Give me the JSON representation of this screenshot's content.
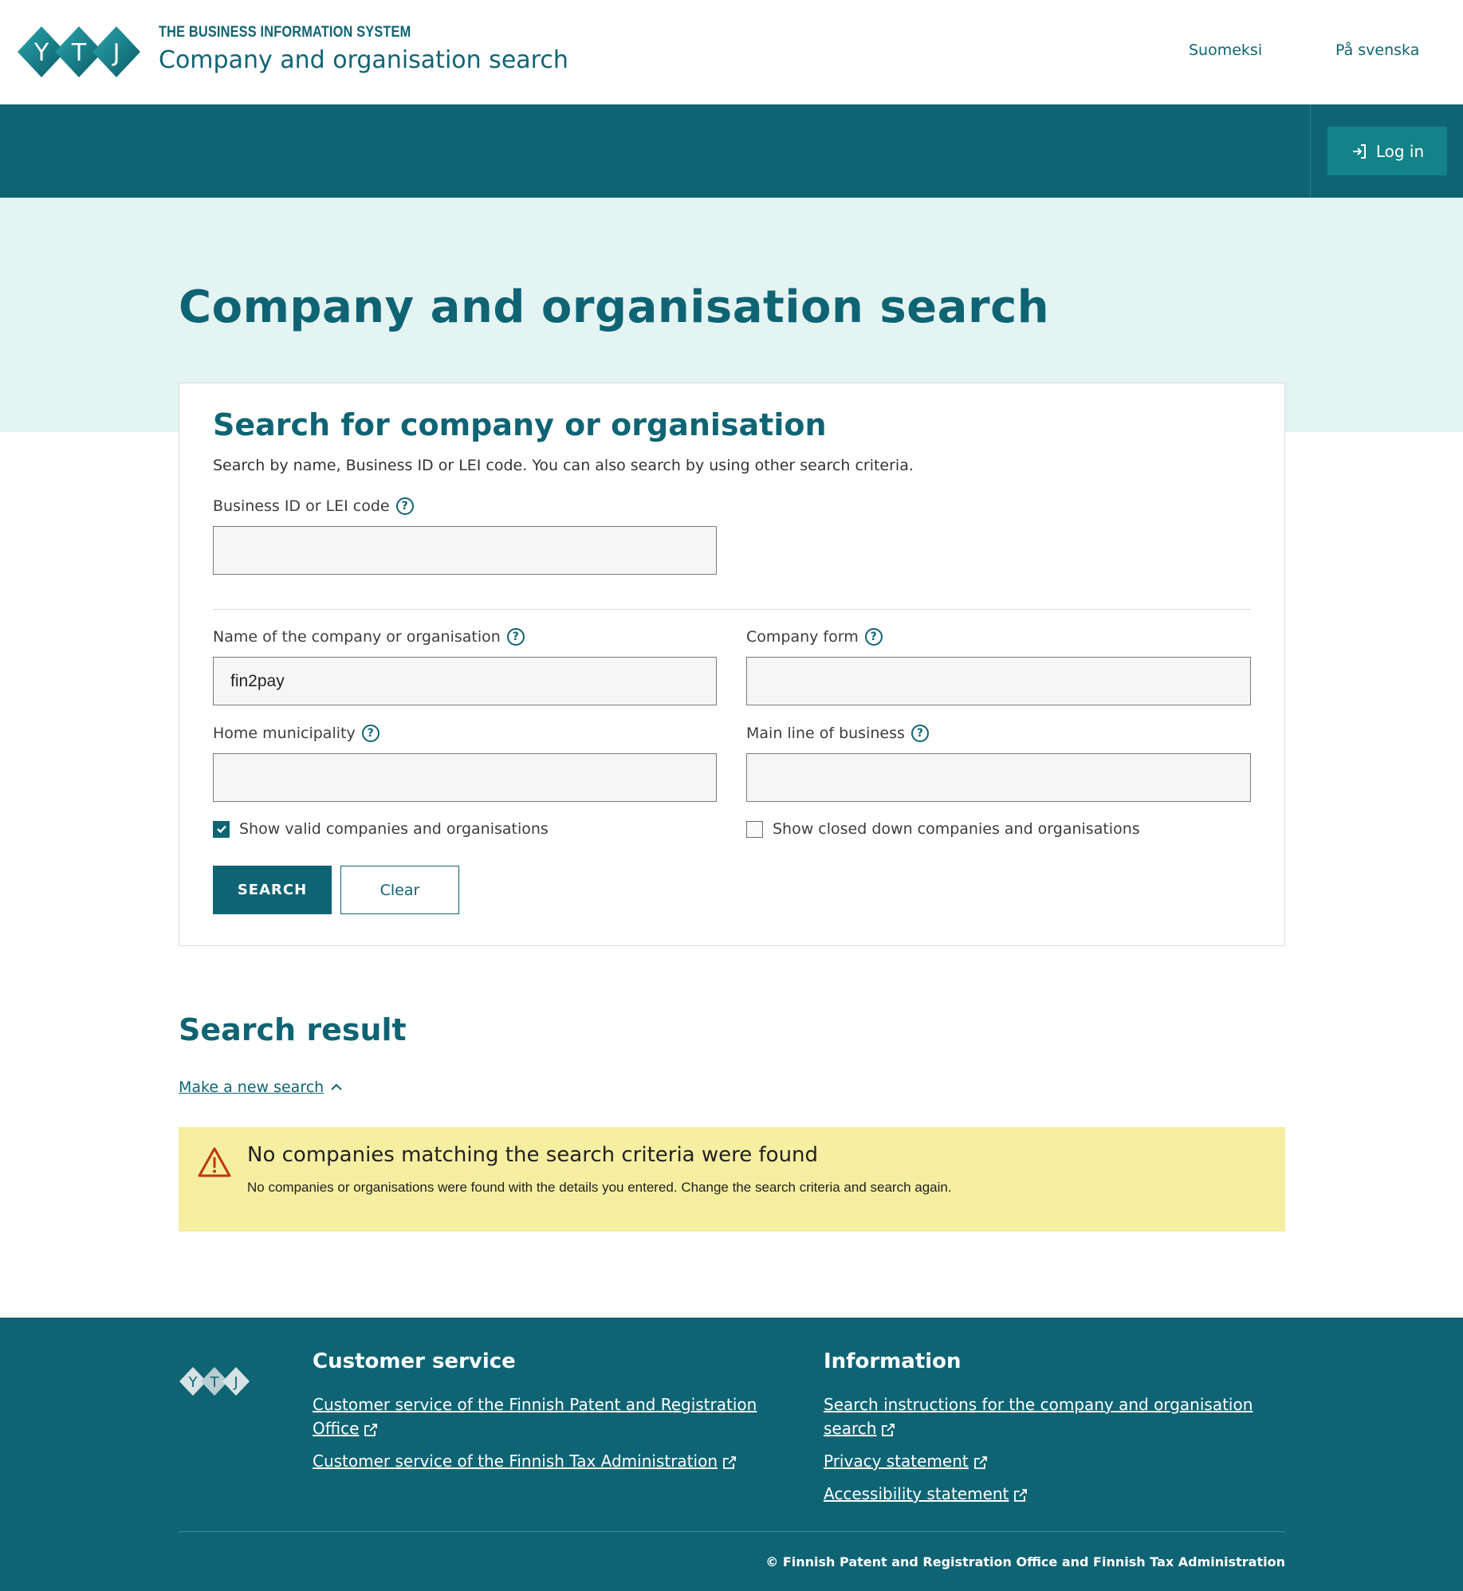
{
  "header": {
    "logo_text": "YTJ",
    "kicker": "THE BUSINESS INFORMATION SYSTEM",
    "title": "Company and organisation search",
    "lang_fi": "Suomeksi",
    "lang_sv": "På svenska"
  },
  "nav": {
    "login_label": "Log in"
  },
  "hero": {
    "title": "Company and organisation search"
  },
  "search_form": {
    "title": "Search for company or organisation",
    "description": "Search by name, Business ID or LEI code. You can also search by using other search criteria.",
    "business_id": {
      "label": "Business ID or LEI code",
      "value": ""
    },
    "name": {
      "label": "Name of the company or organisation",
      "value": "fin2pay"
    },
    "company_form": {
      "label": "Company form",
      "value": ""
    },
    "home_municipality": {
      "label": "Home municipality",
      "value": ""
    },
    "main_line": {
      "label": "Main line of business",
      "value": ""
    },
    "show_valid": {
      "label": "Show valid companies and organisations",
      "checked": true
    },
    "show_closed": {
      "label": "Show closed down companies and organisations",
      "checked": false
    },
    "search_label": "SEARCH",
    "clear_label": "Clear"
  },
  "results": {
    "title": "Search result",
    "new_search_label": "Make a new search",
    "alert_title": "No companies matching the search criteria were found",
    "alert_text": "No companies or organisations were found with the details you entered. Change the search criteria and search again."
  },
  "footer": {
    "customer_service": {
      "heading": "Customer service",
      "prh_line1": "Customer service of the Finnish Patent and Registration",
      "prh_line2": "Office",
      "tax": "Customer service of the Finnish Tax Administration"
    },
    "information": {
      "heading": "Information",
      "instructions_line1": "Search instructions for the company and organisation",
      "instructions_line2": "search",
      "privacy": "Privacy statement",
      "accessibility": "Accessibility statement"
    },
    "copyright": "© Finnish Patent and Registration Office and Finnish Tax Administration"
  },
  "colors": {
    "brand": "#0f6474",
    "accent": "#138389",
    "hero_bg": "#e4f4f3",
    "alert_bg": "#f6eea1",
    "alert_icon": "#c0360c"
  }
}
